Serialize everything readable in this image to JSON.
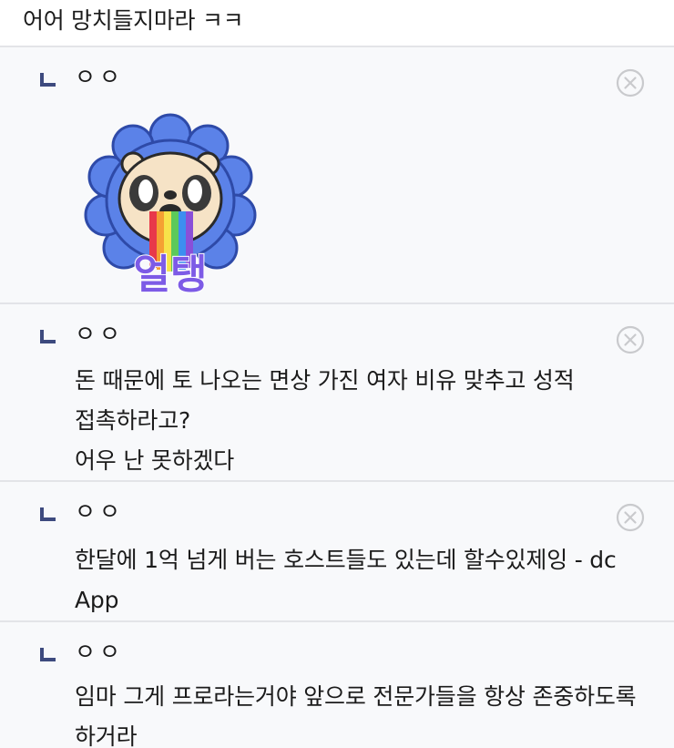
{
  "top_comment": {
    "text": "어어 망치들지마라 ㅋㅋ"
  },
  "replies": [
    {
      "nick": "ㅇㅇ",
      "text": "",
      "sticker": {
        "label": "얼탱",
        "icon": "bear-rainbow-sticker"
      },
      "has_delete": true
    },
    {
      "nick": "ㅇㅇ",
      "text": "돈 때문에 토 나오는 면상 가진 여자 비유 맞추고 성적 접촉하라고?\n어우 난 못하겠다",
      "has_delete": true
    },
    {
      "nick": "ㅇㅇ",
      "text": "한달에 1억 넘게 버는 호스트들도 있는데 할수있제잉 - dc App",
      "has_delete": true
    },
    {
      "nick": "ㅇㅇ",
      "text": "임마 그게 프로라는거야 앞으로 전문가들을 항상 존중하도록 하거라",
      "has_delete": false
    }
  ],
  "icons": {
    "reply_arrow": "reply-arrow-icon",
    "delete": "delete-circle-icon"
  },
  "colors": {
    "reply_bg": "#f8f9fb",
    "divider": "#e3e4e8",
    "arrow": "#3d4a7e",
    "delete_icon": "#c9cacd"
  }
}
